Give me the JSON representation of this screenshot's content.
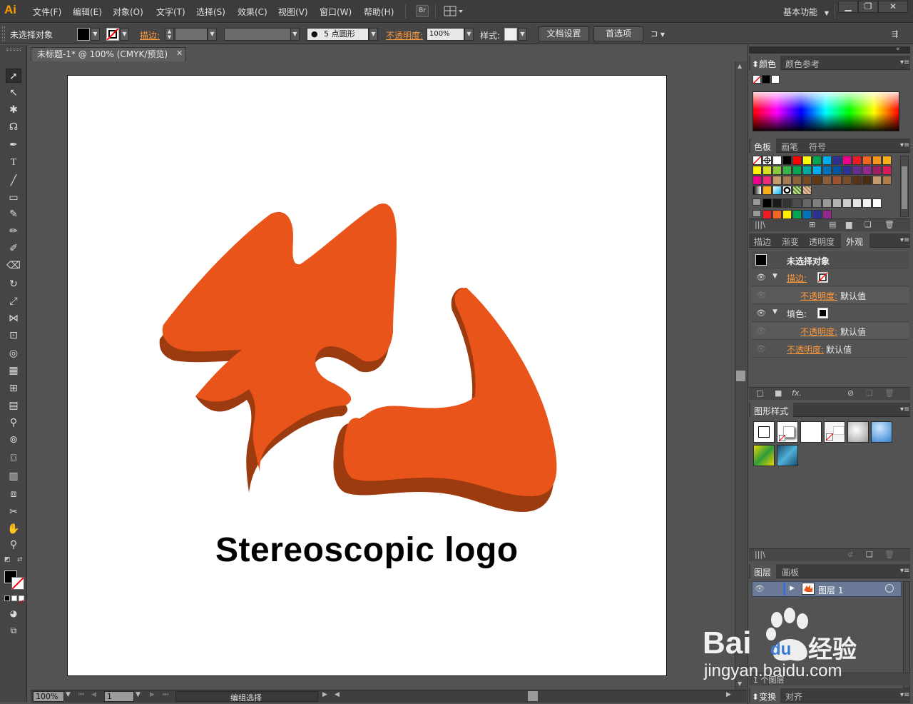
{
  "app": {
    "logo": "Ai"
  },
  "menu": {
    "items": [
      "文件(F)",
      "编辑(E)",
      "对象(O)",
      "文字(T)",
      "选择(S)",
      "效果(C)",
      "视图(V)",
      "窗口(W)",
      "帮助(H)"
    ],
    "bridge_label": "Br",
    "workspace": "基本功能"
  },
  "control": {
    "selection_status": "未选择对象",
    "stroke_label": "描边:",
    "brush_label": "5 点圆形",
    "opacity_label": "不透明度:",
    "opacity_value": "100%",
    "style_label": "样式:",
    "doc_setup": "文档设置",
    "preferences": "首选项"
  },
  "document": {
    "tab_title": "未标题-1* @ 100% (CMYK/预览)",
    "logo_text": "Stereoscopic logo",
    "logo_colors": {
      "face": "#E8541A",
      "side": "#9C3A10"
    }
  },
  "status": {
    "zoom": "100%",
    "artboard_num": "1",
    "tool_status": "编组选择"
  },
  "panels": {
    "color": {
      "tabs": [
        "颜色",
        "颜色参考"
      ]
    },
    "swatches": {
      "tabs": [
        "色板",
        "画笔",
        "符号"
      ],
      "rows": [
        [
          "none",
          "reg",
          "#ffffff",
          "#000000",
          "#ff0000",
          "#ffff00",
          "#00a651",
          "#00aeef",
          "#2e3192",
          "#ec008c",
          "#ed1c24",
          "#f26522",
          "#f7941d",
          "#f9ad1a"
        ],
        [
          "#fff200",
          "#d7df23",
          "#8dc63f",
          "#39b54a",
          "#00a651",
          "#00a99d",
          "#00aeef",
          "#0072bc",
          "#0054a6",
          "#2e3192",
          "#662d91",
          "#92278f",
          "#9e1f63",
          "#d91b5c"
        ],
        [
          "#ec008c",
          "#ee2a7b",
          "#c69c6d",
          "#a67c52",
          "#8c6239",
          "#754c24",
          "#603913",
          "#8b5e3c",
          "#a0522d",
          "#7b4b2a",
          "#5c3317",
          "#4a2c0f",
          "#c49a6c",
          "#b07d48"
        ]
      ],
      "gray_row": [
        "#000000",
        "#1a1a1a",
        "#333333",
        "#4d4d4d",
        "#666666",
        "#808080",
        "#999999",
        "#b3b3b3",
        "#cccccc",
        "#e6e6e6",
        "#f2f2f2",
        "#ffffff"
      ],
      "last_row": [
        "#ed1c24",
        "#f26522",
        "#fff200",
        "#00a651",
        "#0072bc",
        "#2e3192",
        "#92278f"
      ]
    },
    "appearance": {
      "tabs": [
        "描边",
        "渐变",
        "透明度",
        "外观"
      ],
      "title": "未选择对象",
      "stroke_label": "描边:",
      "opacity_label": "不透明度:",
      "default_value": "默认值",
      "fill_label": "填色:"
    },
    "graphic_styles": {
      "tab": "图形样式"
    },
    "layers": {
      "tabs": [
        "图层",
        "画板"
      ],
      "layer_name": "图层 1",
      "count_text": "1 个图层"
    },
    "transform": {
      "tabs": [
        "变换",
        "对齐"
      ]
    }
  },
  "watermark": {
    "brand": "Bai",
    "brand_cn": "经验",
    "url": "jingyan.baidu.com"
  }
}
